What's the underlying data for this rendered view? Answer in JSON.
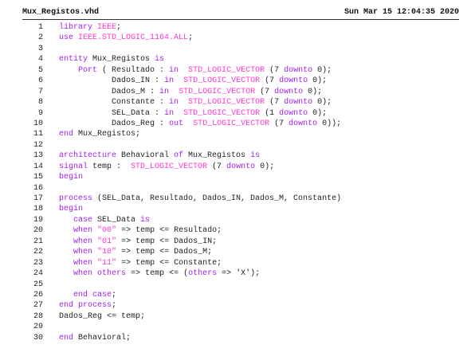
{
  "header": {
    "filename": "Mux_Registos.vhd",
    "datetime": "Sun Mar 15 12:04:35 2020"
  },
  "colors": {
    "keyword": "#a020f0",
    "literal": "#ff33cc",
    "text": "#222222"
  },
  "code_lines": [
    {
      "n": "1",
      "t": [
        [
          "k",
          "library"
        ],
        [
          "x",
          " "
        ],
        [
          "l",
          "IEEE"
        ],
        [
          "x",
          ";"
        ]
      ]
    },
    {
      "n": "2",
      "t": [
        [
          "k",
          "use"
        ],
        [
          "x",
          " "
        ],
        [
          "l",
          "IEEE.STD_LOGIC_1164.ALL"
        ],
        [
          "x",
          ";"
        ]
      ]
    },
    {
      "n": "3",
      "t": []
    },
    {
      "n": "4",
      "t": [
        [
          "k",
          "entity"
        ],
        [
          "x",
          " Mux_Registos "
        ],
        [
          "k",
          "is"
        ]
      ]
    },
    {
      "n": "5",
      "t": [
        [
          "x",
          "    "
        ],
        [
          "k",
          "Port"
        ],
        [
          "x",
          " ( Resultado : "
        ],
        [
          "k",
          "in"
        ],
        [
          "x",
          "  "
        ],
        [
          "l",
          "STD_LOGIC_VECTOR"
        ],
        [
          "x",
          " (7 "
        ],
        [
          "k",
          "downto"
        ],
        [
          "x",
          " 0);"
        ]
      ]
    },
    {
      "n": "6",
      "t": [
        [
          "x",
          "           Dados_IN : "
        ],
        [
          "k",
          "in"
        ],
        [
          "x",
          "  "
        ],
        [
          "l",
          "STD_LOGIC_VECTOR"
        ],
        [
          "x",
          " (7 "
        ],
        [
          "k",
          "downto"
        ],
        [
          "x",
          " 0);"
        ]
      ]
    },
    {
      "n": "7",
      "t": [
        [
          "x",
          "           Dados_M : "
        ],
        [
          "k",
          "in"
        ],
        [
          "x",
          "  "
        ],
        [
          "l",
          "STD_LOGIC_VECTOR"
        ],
        [
          "x",
          " (7 "
        ],
        [
          "k",
          "downto"
        ],
        [
          "x",
          " 0);"
        ]
      ]
    },
    {
      "n": "8",
      "t": [
        [
          "x",
          "           Constante : "
        ],
        [
          "k",
          "in"
        ],
        [
          "x",
          "  "
        ],
        [
          "l",
          "STD_LOGIC_VECTOR"
        ],
        [
          "x",
          " (7 "
        ],
        [
          "k",
          "downto"
        ],
        [
          "x",
          " 0);"
        ]
      ]
    },
    {
      "n": "9",
      "t": [
        [
          "x",
          "           SEL_Data : "
        ],
        [
          "k",
          "in"
        ],
        [
          "x",
          "  "
        ],
        [
          "l",
          "STD_LOGIC_VECTOR"
        ],
        [
          "x",
          " (1 "
        ],
        [
          "k",
          "downto"
        ],
        [
          "x",
          " 0);"
        ]
      ]
    },
    {
      "n": "10",
      "t": [
        [
          "x",
          "           Dados_Reg : "
        ],
        [
          "k",
          "out"
        ],
        [
          "x",
          "  "
        ],
        [
          "l",
          "STD_LOGIC_VECTOR"
        ],
        [
          "x",
          " (7 "
        ],
        [
          "k",
          "downto"
        ],
        [
          "x",
          " 0));"
        ]
      ]
    },
    {
      "n": "11",
      "t": [
        [
          "k",
          "end"
        ],
        [
          "x",
          " Mux_Registos;"
        ]
      ]
    },
    {
      "n": "12",
      "t": []
    },
    {
      "n": "13",
      "t": [
        [
          "k",
          "architecture"
        ],
        [
          "x",
          " Behavioral "
        ],
        [
          "k",
          "of"
        ],
        [
          "x",
          " Mux_Registos "
        ],
        [
          "k",
          "is"
        ]
      ]
    },
    {
      "n": "14",
      "t": [
        [
          "k",
          "signal"
        ],
        [
          "x",
          " temp :  "
        ],
        [
          "l",
          "STD_LOGIC_VECTOR"
        ],
        [
          "x",
          " (7 "
        ],
        [
          "k",
          "downto"
        ],
        [
          "x",
          " 0);"
        ]
      ]
    },
    {
      "n": "15",
      "t": [
        [
          "k",
          "begin"
        ]
      ]
    },
    {
      "n": "16",
      "t": []
    },
    {
      "n": "17",
      "t": [
        [
          "k",
          "process"
        ],
        [
          "x",
          " (SEL_Data, Resultado, Dados_IN, Dados_M, Constante)"
        ]
      ]
    },
    {
      "n": "18",
      "t": [
        [
          "k",
          "begin"
        ]
      ]
    },
    {
      "n": "19",
      "t": [
        [
          "x",
          "   "
        ],
        [
          "k",
          "case"
        ],
        [
          "x",
          " SEL_Data "
        ],
        [
          "k",
          "is"
        ]
      ]
    },
    {
      "n": "20",
      "t": [
        [
          "x",
          "   "
        ],
        [
          "k",
          "when"
        ],
        [
          "x",
          " "
        ],
        [
          "l",
          "\"00\""
        ],
        [
          "x",
          " => temp <= Resultado;"
        ]
      ]
    },
    {
      "n": "21",
      "t": [
        [
          "x",
          "   "
        ],
        [
          "k",
          "when"
        ],
        [
          "x",
          " "
        ],
        [
          "l",
          "\"01\""
        ],
        [
          "x",
          " => temp <= Dados_IN;"
        ]
      ]
    },
    {
      "n": "22",
      "t": [
        [
          "x",
          "   "
        ],
        [
          "k",
          "when"
        ],
        [
          "x",
          " "
        ],
        [
          "l",
          "\"10\""
        ],
        [
          "x",
          " => temp <= Dados_M;"
        ]
      ]
    },
    {
      "n": "23",
      "t": [
        [
          "x",
          "   "
        ],
        [
          "k",
          "when"
        ],
        [
          "x",
          " "
        ],
        [
          "l",
          "\"11\""
        ],
        [
          "x",
          " => temp <= Constante;"
        ]
      ]
    },
    {
      "n": "24",
      "t": [
        [
          "x",
          "   "
        ],
        [
          "k",
          "when"
        ],
        [
          "x",
          " "
        ],
        [
          "k",
          "others"
        ],
        [
          "x",
          " => temp <= ("
        ],
        [
          "k",
          "others"
        ],
        [
          "x",
          " => 'X');"
        ]
      ]
    },
    {
      "n": "25",
      "t": []
    },
    {
      "n": "26",
      "t": [
        [
          "x",
          "   "
        ],
        [
          "k",
          "end case"
        ],
        [
          "x",
          ";"
        ]
      ]
    },
    {
      "n": "27",
      "t": [
        [
          "k",
          "end process"
        ],
        [
          "x",
          ";"
        ]
      ]
    },
    {
      "n": "28",
      "t": [
        [
          "x",
          "Dados_Reg <= temp;"
        ]
      ]
    },
    {
      "n": "29",
      "t": []
    },
    {
      "n": "30",
      "t": [
        [
          "k",
          "end"
        ],
        [
          "x",
          " Behavioral;"
        ]
      ]
    }
  ]
}
